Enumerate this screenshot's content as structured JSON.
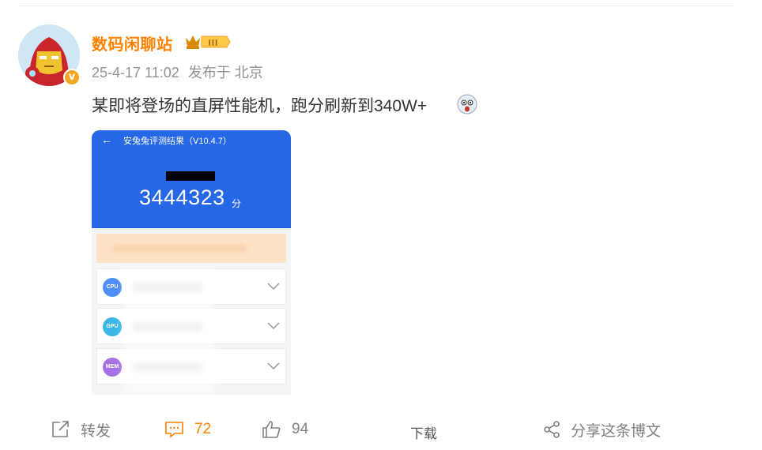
{
  "post": {
    "username": "数码闲聊站",
    "vip_level": "III",
    "timestamp": "25-4-17 11:02",
    "source": "发布于 北京",
    "text": "某即将登场的直屏性能机，跑分刷新到340W+"
  },
  "screenshot": {
    "title": "安兔兔评测结果（V10.4.7）",
    "score": "3444323",
    "score_unit": "分",
    "rows": [
      {
        "chip": "CPU",
        "color": "#4f8ff7"
      },
      {
        "chip": "GPU",
        "color": "#3cb8e6"
      },
      {
        "chip": "MEM",
        "color": "#a472e4"
      }
    ]
  },
  "actions": {
    "repost_label": "转发",
    "comment_count": "72",
    "like_count": "94",
    "download_label": "下载",
    "share_label": "分享这条博文"
  },
  "colors": {
    "accent": "#ff8200",
    "benchmark_blue": "#2567e6"
  }
}
